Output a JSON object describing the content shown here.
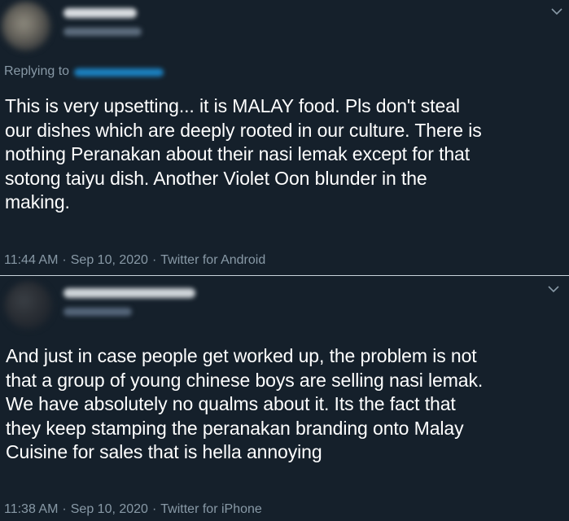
{
  "tweets": [
    {
      "replying_to_label": "Replying to",
      "text": "This is very upsetting... it is MALAY food. Pls don't steal\nour dishes which are deeply rooted in our culture. There is\nnothing Peranakan about their nasi lemak except for that\nsotong taiyu dish. Another Violet Oon blunder in the\nmaking.",
      "time": "11:44 AM",
      "date": "Sep 10, 2020",
      "source": "Twitter for Android",
      "separator": "·"
    },
    {
      "text": "And just in case people get worked up, the problem is not\nthat a group of young chinese boys are selling nasi lemak.\nWe have absolutely no qualms about it. Its the fact that\nthey keep stamping the peranakan branding onto Malay\nCuisine for sales that is hella annoying",
      "time": "11:38 AM",
      "date": "Sep 10, 2020",
      "source": "Twitter for iPhone",
      "separator": "·"
    }
  ],
  "icons": {
    "more": "chevron-down-icon"
  },
  "colors": {
    "background": "#15202b",
    "text": "#ffffff",
    "secondary_text": "#8899a6",
    "link": "#1da1f2",
    "divider": "#c9d3db"
  }
}
